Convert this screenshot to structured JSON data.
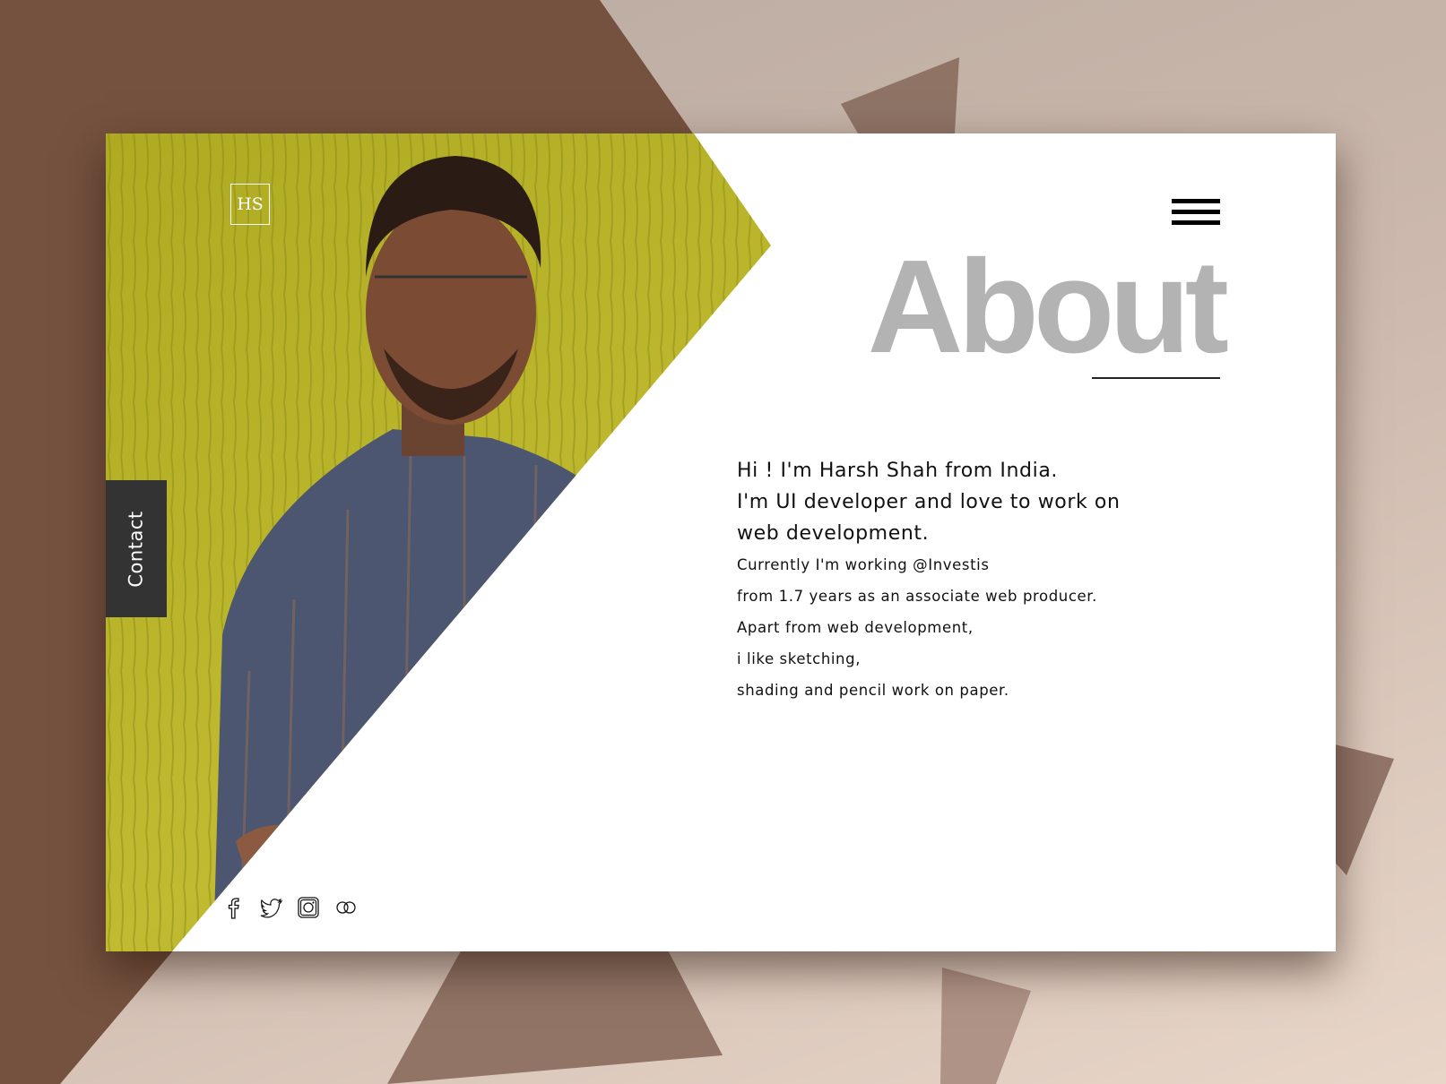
{
  "colors": {
    "background_dark": "#75523f",
    "card": "#ffffff",
    "heading": "#b3b3b3",
    "contact_tab": "#333333",
    "photo_wall": "#b8b32a"
  },
  "logo": {
    "text": "HS"
  },
  "contact_tab": {
    "label": "Contact"
  },
  "menu": {
    "icon": "hamburger-icon"
  },
  "heading": {
    "title": "About"
  },
  "intro": {
    "lines_large": [
      "Hi ! I'm Harsh Shah from India.",
      "I'm UI developer and love to work on",
      "web development."
    ],
    "lines_small": [
      "Currently I'm working @Investis",
      "from 1.7 years as an associate web producer.",
      "Apart from web development,",
      "i like sketching,",
      "shading and pencil work on paper."
    ]
  },
  "social": [
    {
      "icon": "facebook-icon"
    },
    {
      "icon": "twitter-icon"
    },
    {
      "icon": "instagram-icon"
    },
    {
      "icon": "flickr-icon"
    }
  ]
}
